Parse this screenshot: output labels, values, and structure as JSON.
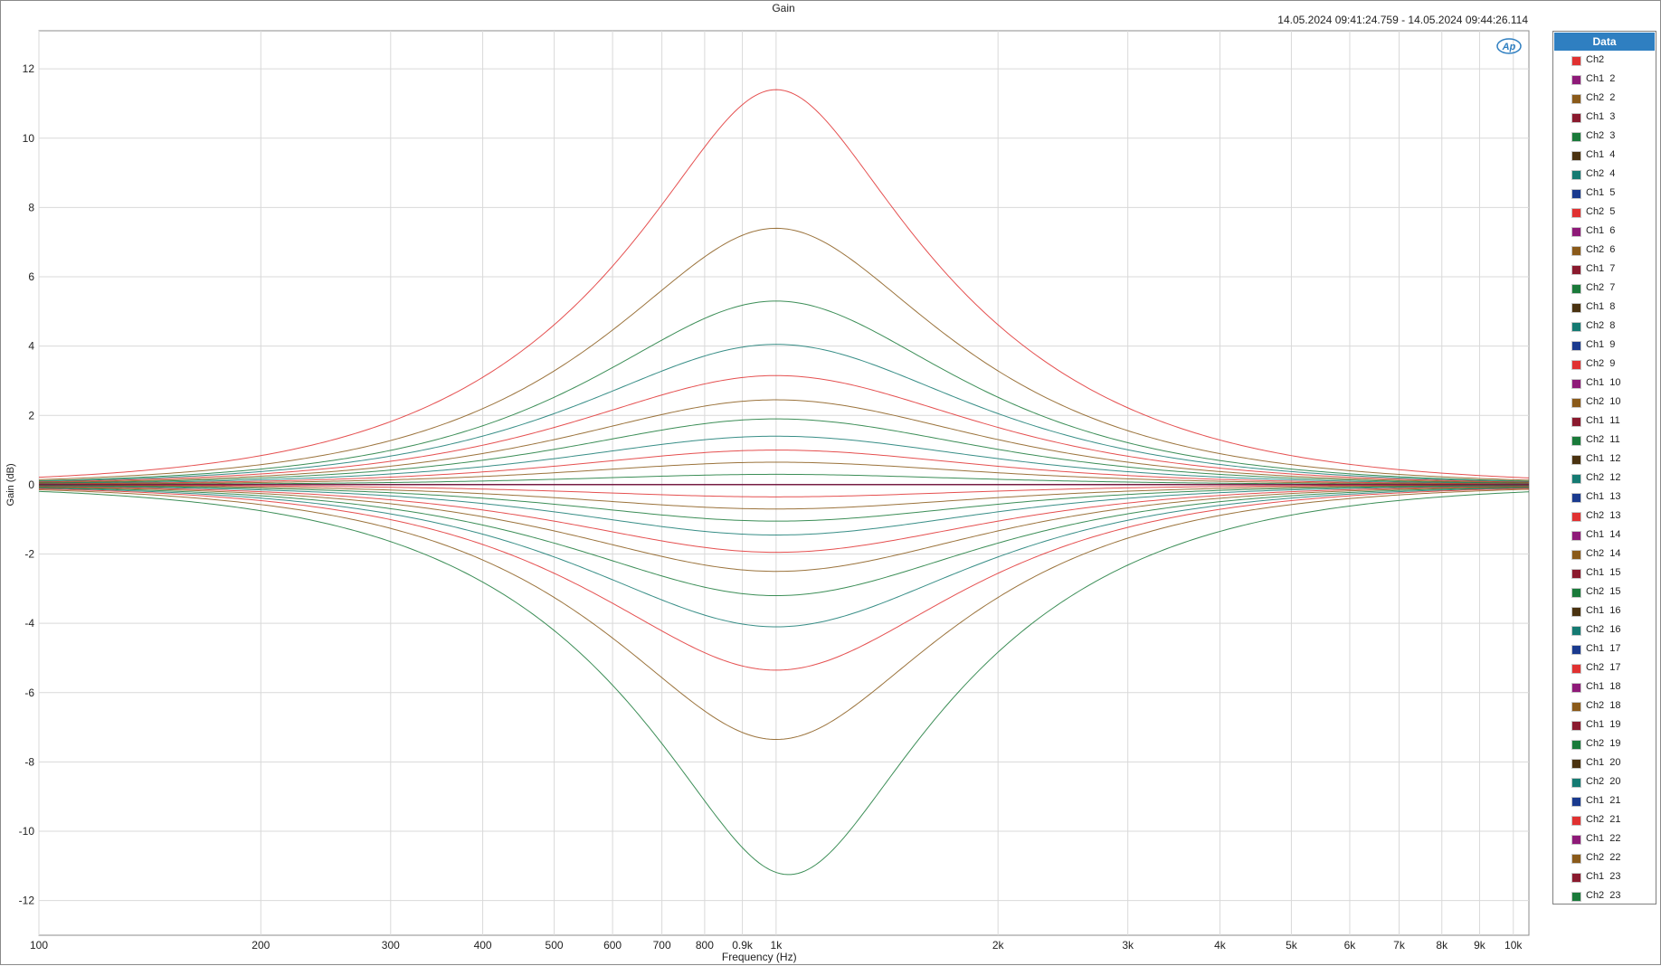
{
  "window": {
    "title": "Gain",
    "time_range": "14.05.2024 09:41:24.759 - 14.05.2024 09:44:26.114",
    "logo_text": "Ap"
  },
  "legend": {
    "header": "Data",
    "items": [
      {
        "label": "Ch2",
        "color": "#e03131"
      },
      {
        "label": "Ch1  2",
        "color": "#8e1a78"
      },
      {
        "label": "Ch2  2",
        "color": "#8a5a1a"
      },
      {
        "label": "Ch1  3",
        "color": "#8a1a2e"
      },
      {
        "label": "Ch2  3",
        "color": "#1a7a3a"
      },
      {
        "label": "Ch1  4",
        "color": "#4a3210"
      },
      {
        "label": "Ch2  4",
        "color": "#157a72"
      },
      {
        "label": "Ch1  5",
        "color": "#1a3a8e"
      },
      {
        "label": "Ch2  5",
        "color": "#e03131"
      },
      {
        "label": "Ch1  6",
        "color": "#8e1a78"
      },
      {
        "label": "Ch2  6",
        "color": "#8a5a1a"
      },
      {
        "label": "Ch1  7",
        "color": "#8a1a2e"
      },
      {
        "label": "Ch2  7",
        "color": "#1a7a3a"
      },
      {
        "label": "Ch1  8",
        "color": "#4a3210"
      },
      {
        "label": "Ch2  8",
        "color": "#157a72"
      },
      {
        "label": "Ch1  9",
        "color": "#1a3a8e"
      },
      {
        "label": "Ch2  9",
        "color": "#e03131"
      },
      {
        "label": "Ch1  10",
        "color": "#8e1a78"
      },
      {
        "label": "Ch2  10",
        "color": "#8a5a1a"
      },
      {
        "label": "Ch1  11",
        "color": "#8a1a2e"
      },
      {
        "label": "Ch2  11",
        "color": "#1a7a3a"
      },
      {
        "label": "Ch1  12",
        "color": "#4a3210"
      },
      {
        "label": "Ch2  12",
        "color": "#157a72"
      },
      {
        "label": "Ch1  13",
        "color": "#1a3a8e"
      },
      {
        "label": "Ch2  13",
        "color": "#e03131"
      },
      {
        "label": "Ch1  14",
        "color": "#8e1a78"
      },
      {
        "label": "Ch2  14",
        "color": "#8a5a1a"
      },
      {
        "label": "Ch1  15",
        "color": "#8a1a2e"
      },
      {
        "label": "Ch2  15",
        "color": "#1a7a3a"
      },
      {
        "label": "Ch1  16",
        "color": "#4a3210"
      },
      {
        "label": "Ch2  16",
        "color": "#157a72"
      },
      {
        "label": "Ch1  17",
        "color": "#1a3a8e"
      },
      {
        "label": "Ch2  17",
        "color": "#e03131"
      },
      {
        "label": "Ch1  18",
        "color": "#8e1a78"
      },
      {
        "label": "Ch2  18",
        "color": "#8a5a1a"
      },
      {
        "label": "Ch1  19",
        "color": "#8a1a2e"
      },
      {
        "label": "Ch2  19",
        "color": "#1a7a3a"
      },
      {
        "label": "Ch1  20",
        "color": "#4a3210"
      },
      {
        "label": "Ch2  20",
        "color": "#157a72"
      },
      {
        "label": "Ch1  21",
        "color": "#1a3a8e"
      },
      {
        "label": "Ch2  21",
        "color": "#e03131"
      },
      {
        "label": "Ch1  22",
        "color": "#8e1a78"
      },
      {
        "label": "Ch2  22",
        "color": "#8a5a1a"
      },
      {
        "label": "Ch1  23",
        "color": "#8a1a2e"
      },
      {
        "label": "Ch2  23",
        "color": "#1a7a3a"
      }
    ]
  },
  "chart_data": {
    "type": "line",
    "title": "Gain",
    "xlabel": "Frequency (Hz)",
    "ylabel": "Gain (dB)",
    "x_scale": "log",
    "xlim": [
      100,
      10500
    ],
    "ylim": [
      -13.0,
      13.1
    ],
    "xticks": [
      {
        "value": 100,
        "label": "100"
      },
      {
        "value": 200,
        "label": "200"
      },
      {
        "value": 300,
        "label": "300"
      },
      {
        "value": 400,
        "label": "400"
      },
      {
        "value": 500,
        "label": "500"
      },
      {
        "value": 600,
        "label": "600"
      },
      {
        "value": 700,
        "label": "700"
      },
      {
        "value": 800,
        "label": "800"
      },
      {
        "value": 900,
        "label": "0.9k"
      },
      {
        "value": 1000,
        "label": "1k"
      },
      {
        "value": 2000,
        "label": "2k"
      },
      {
        "value": 3000,
        "label": "3k"
      },
      {
        "value": 4000,
        "label": "4k"
      },
      {
        "value": 5000,
        "label": "5k"
      },
      {
        "value": 6000,
        "label": "6k"
      },
      {
        "value": 7000,
        "label": "7k"
      },
      {
        "value": 8000,
        "label": "8k"
      },
      {
        "value": 9000,
        "label": "9k"
      },
      {
        "value": 10000,
        "label": "10k"
      }
    ],
    "yticks": [
      {
        "value": 12,
        "label": "12"
      },
      {
        "value": 10,
        "label": "10"
      },
      {
        "value": 8,
        "label": "8"
      },
      {
        "value": 6,
        "label": "6"
      },
      {
        "value": 4,
        "label": "4"
      },
      {
        "value": 2,
        "label": "2"
      },
      {
        "value": 0,
        "label": "0"
      },
      {
        "value": -2,
        "label": "-2"
      },
      {
        "value": -4,
        "label": "-4"
      },
      {
        "value": -6,
        "label": "-6"
      },
      {
        "value": -8,
        "label": "-8"
      },
      {
        "value": -10,
        "label": "-10"
      },
      {
        "value": -12,
        "label": "-12"
      }
    ],
    "grid": true,
    "legend_position": "right",
    "series": [
      {
        "name": "Ch2",
        "color": "#e03131",
        "center_hz": 1000,
        "peak_db": 11.4,
        "q": 1.6
      },
      {
        "name": "Ch1  2",
        "color": "#8e1a78",
        "center_hz": 1000,
        "peak_db": 0.0,
        "q": 0.7
      },
      {
        "name": "Ch2  2",
        "color": "#8a5a1a",
        "center_hz": 1000,
        "peak_db": 7.4,
        "q": 1.15
      },
      {
        "name": "Ch1  3",
        "color": "#8a1a2e",
        "center_hz": 1000,
        "peak_db": 0.0,
        "q": 0.7
      },
      {
        "name": "Ch2  3",
        "color": "#1a7a3a",
        "center_hz": 1000,
        "peak_db": 5.3,
        "q": 0.95
      },
      {
        "name": "Ch1  4",
        "color": "#4a3210",
        "center_hz": 1000,
        "peak_db": 0.0,
        "q": 0.7
      },
      {
        "name": "Ch2  4",
        "color": "#157a72",
        "center_hz": 1000,
        "peak_db": 4.05,
        "q": 0.83
      },
      {
        "name": "Ch1  5",
        "color": "#1a3a8e",
        "center_hz": 1000,
        "peak_db": 0.0,
        "q": 0.7
      },
      {
        "name": "Ch2  5",
        "color": "#e03131",
        "center_hz": 1000,
        "peak_db": 3.15,
        "q": 0.76
      },
      {
        "name": "Ch1  6",
        "color": "#8e1a78",
        "center_hz": 1000,
        "peak_db": 0.0,
        "q": 0.7
      },
      {
        "name": "Ch2  6",
        "color": "#8a5a1a",
        "center_hz": 1000,
        "peak_db": 2.45,
        "q": 0.72
      },
      {
        "name": "Ch1  7",
        "color": "#8a1a2e",
        "center_hz": 1000,
        "peak_db": 0.0,
        "q": 0.7
      },
      {
        "name": "Ch2  7",
        "color": "#1a7a3a",
        "center_hz": 1000,
        "peak_db": 1.9,
        "q": 0.69
      },
      {
        "name": "Ch1  8",
        "color": "#4a3210",
        "center_hz": 1000,
        "peak_db": 0.0,
        "q": 0.7
      },
      {
        "name": "Ch2  8",
        "color": "#157a72",
        "center_hz": 1000,
        "peak_db": 1.4,
        "q": 0.67
      },
      {
        "name": "Ch1  9",
        "color": "#1a3a8e",
        "center_hz": 1000,
        "peak_db": 0.0,
        "q": 0.7
      },
      {
        "name": "Ch2  9",
        "color": "#e03131",
        "center_hz": 1000,
        "peak_db": 1.0,
        "q": 0.66
      },
      {
        "name": "Ch1  10",
        "color": "#8e1a78",
        "center_hz": 1000,
        "peak_db": 0.0,
        "q": 0.7
      },
      {
        "name": "Ch2  10",
        "color": "#8a5a1a",
        "center_hz": 1000,
        "peak_db": 0.65,
        "q": 0.65
      },
      {
        "name": "Ch1  11",
        "color": "#8a1a2e",
        "center_hz": 1000,
        "peak_db": 0.0,
        "q": 0.7
      },
      {
        "name": "Ch2  11",
        "color": "#1a7a3a",
        "center_hz": 1000,
        "peak_db": 0.3,
        "q": 0.65
      },
      {
        "name": "Ch1  12",
        "color": "#4a3210",
        "center_hz": 1000,
        "peak_db": 0.0,
        "q": 0.7
      },
      {
        "name": "Ch2  12",
        "color": "#157a72",
        "center_hz": 1000,
        "peak_db": 0.0,
        "q": 0.65
      },
      {
        "name": "Ch1  13",
        "color": "#1a3a8e",
        "center_hz": 1000,
        "peak_db": 0.0,
        "q": 0.7
      },
      {
        "name": "Ch2  13",
        "color": "#e03131",
        "center_hz": 1000,
        "peak_db": -0.35,
        "q": 0.65
      },
      {
        "name": "Ch1  14",
        "color": "#8e1a78",
        "center_hz": 1000,
        "peak_db": 0.0,
        "q": 0.7
      },
      {
        "name": "Ch2  14",
        "color": "#8a5a1a",
        "center_hz": 1000,
        "peak_db": -0.7,
        "q": 0.65
      },
      {
        "name": "Ch1  15",
        "color": "#8a1a2e",
        "center_hz": 1000,
        "peak_db": 0.0,
        "q": 0.7
      },
      {
        "name": "Ch2  15",
        "color": "#1a7a3a",
        "center_hz": 1000,
        "peak_db": -1.05,
        "q": 0.66
      },
      {
        "name": "Ch1  16",
        "color": "#4a3210",
        "center_hz": 1000,
        "peak_db": 0.0,
        "q": 0.7
      },
      {
        "name": "Ch2  16",
        "color": "#157a72",
        "center_hz": 1000,
        "peak_db": -1.45,
        "q": 0.67
      },
      {
        "name": "Ch1  17",
        "color": "#1a3a8e",
        "center_hz": 1000,
        "peak_db": 0.0,
        "q": 0.7
      },
      {
        "name": "Ch2  17",
        "color": "#e03131",
        "center_hz": 1000,
        "peak_db": -1.95,
        "q": 0.69
      },
      {
        "name": "Ch1  18",
        "color": "#8e1a78",
        "center_hz": 1000,
        "peak_db": 0.0,
        "q": 0.7
      },
      {
        "name": "Ch2  18",
        "color": "#8a5a1a",
        "center_hz": 1000,
        "peak_db": -2.5,
        "q": 0.72
      },
      {
        "name": "Ch1  19",
        "color": "#8a1a2e",
        "center_hz": 1000,
        "peak_db": 0.0,
        "q": 0.7
      },
      {
        "name": "Ch2  19",
        "color": "#1a7a3a",
        "center_hz": 1000,
        "peak_db": -3.2,
        "q": 0.76
      },
      {
        "name": "Ch1  20",
        "color": "#4a3210",
        "center_hz": 1000,
        "peak_db": 0.0,
        "q": 0.7
      },
      {
        "name": "Ch2  20",
        "color": "#157a72",
        "center_hz": 1000,
        "peak_db": -4.1,
        "q": 0.83
      },
      {
        "name": "Ch1  21",
        "color": "#1a3a8e",
        "center_hz": 1000,
        "peak_db": 0.0,
        "q": 0.7
      },
      {
        "name": "Ch2  21",
        "color": "#e03131",
        "center_hz": 1000,
        "peak_db": -5.35,
        "q": 0.95
      },
      {
        "name": "Ch1  22",
        "color": "#8e1a78",
        "center_hz": 1000,
        "peak_db": 0.0,
        "q": 0.7
      },
      {
        "name": "Ch2  22",
        "color": "#8a5a1a",
        "center_hz": 1000,
        "peak_db": -7.35,
        "q": 1.15
      },
      {
        "name": "Ch1  23",
        "color": "#8a1a2e",
        "center_hz": 1000,
        "peak_db": 0.0,
        "q": 0.7
      },
      {
        "name": "Ch2  23",
        "color": "#1a7a3a",
        "center_hz": 1040,
        "peak_db": -11.25,
        "q": 1.6
      }
    ]
  }
}
